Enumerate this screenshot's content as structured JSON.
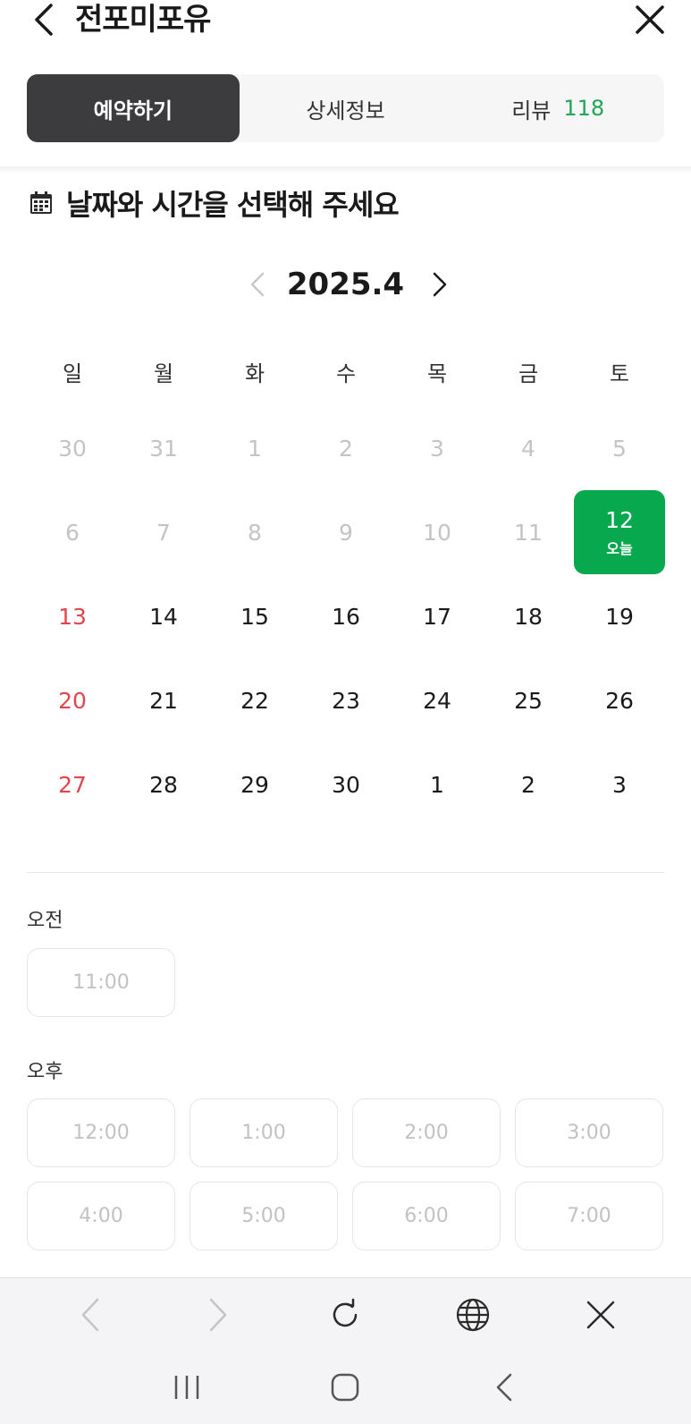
{
  "header": {
    "title": "전포미포유",
    "back_icon": "chevron-left-icon",
    "close_icon": "close-icon"
  },
  "tabs": [
    {
      "label": "예약하기",
      "active": true
    },
    {
      "label": "상세정보",
      "active": false
    },
    {
      "label": "리뷰",
      "count": "118",
      "active": false
    }
  ],
  "section": {
    "title": "날짜와 시간을 선택해 주세요",
    "icon": "calendar-icon"
  },
  "month_nav": {
    "label": "2025.4"
  },
  "weekdays": [
    "일",
    "월",
    "화",
    "수",
    "목",
    "금",
    "토"
  ],
  "calendar": {
    "rows": [
      [
        {
          "d": "30",
          "state": "muted"
        },
        {
          "d": "31",
          "state": "muted"
        },
        {
          "d": "1",
          "state": "muted"
        },
        {
          "d": "2",
          "state": "muted"
        },
        {
          "d": "3",
          "state": "muted"
        },
        {
          "d": "4",
          "state": "muted"
        },
        {
          "d": "5",
          "state": "muted"
        }
      ],
      [
        {
          "d": "6",
          "state": "muted"
        },
        {
          "d": "7",
          "state": "muted"
        },
        {
          "d": "8",
          "state": "muted"
        },
        {
          "d": "9",
          "state": "muted"
        },
        {
          "d": "10",
          "state": "muted"
        },
        {
          "d": "11",
          "state": "muted"
        },
        {
          "d": "12",
          "state": "today",
          "sub": "오늘"
        }
      ],
      [
        {
          "d": "13",
          "state": "sunday"
        },
        {
          "d": "14",
          "state": "normal"
        },
        {
          "d": "15",
          "state": "normal"
        },
        {
          "d": "16",
          "state": "normal"
        },
        {
          "d": "17",
          "state": "normal"
        },
        {
          "d": "18",
          "state": "normal"
        },
        {
          "d": "19",
          "state": "normal"
        }
      ],
      [
        {
          "d": "20",
          "state": "sunday"
        },
        {
          "d": "21",
          "state": "normal"
        },
        {
          "d": "22",
          "state": "normal"
        },
        {
          "d": "23",
          "state": "normal"
        },
        {
          "d": "24",
          "state": "normal"
        },
        {
          "d": "25",
          "state": "normal"
        },
        {
          "d": "26",
          "state": "normal"
        }
      ],
      [
        {
          "d": "27",
          "state": "sunday"
        },
        {
          "d": "28",
          "state": "normal"
        },
        {
          "d": "29",
          "state": "normal"
        },
        {
          "d": "30",
          "state": "normal"
        },
        {
          "d": "1",
          "state": "normal"
        },
        {
          "d": "2",
          "state": "normal"
        },
        {
          "d": "3",
          "state": "normal"
        }
      ]
    ]
  },
  "morning": {
    "label": "오전",
    "slots": [
      "11:00"
    ]
  },
  "afternoon": {
    "label": "오후",
    "slots": [
      "12:00",
      "1:00",
      "2:00",
      "3:00",
      "4:00",
      "5:00",
      "6:00",
      "7:00"
    ]
  },
  "browser_bar": {
    "icons": [
      "back-icon",
      "forward-icon",
      "refresh-icon",
      "globe-icon",
      "close-icon"
    ]
  },
  "system_nav": {
    "icons": [
      "recent-apps-icon",
      "home-icon",
      "back-icon"
    ]
  },
  "colors": {
    "accent_green": "#08a84f",
    "review_count": "#1fa556",
    "sunday_red": "#e0464b",
    "active_tab": "#3c3c3e",
    "muted_text": "#c4c4c4"
  }
}
